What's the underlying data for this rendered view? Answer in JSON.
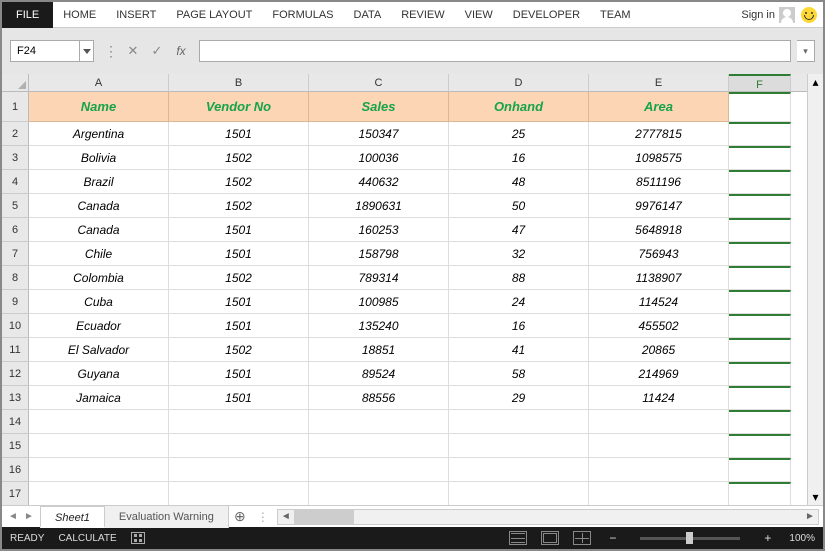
{
  "ribbon": {
    "file": "FILE",
    "tabs": [
      "HOME",
      "INSERT",
      "PAGE LAYOUT",
      "FORMULAS",
      "DATA",
      "REVIEW",
      "VIEW",
      "DEVELOPER",
      "TEAM"
    ],
    "signin": "Sign in"
  },
  "namebox": {
    "value": "F24"
  },
  "fx_label": "fx",
  "formula": {
    "value": ""
  },
  "columns": [
    "A",
    "B",
    "C",
    "D",
    "E",
    "F"
  ],
  "header_row": [
    "Name",
    "Vendor No",
    "Sales",
    "Onhand",
    "Area"
  ],
  "chart_data": {
    "type": "table",
    "columns": [
      "Name",
      "Vendor No",
      "Sales",
      "Onhand",
      "Area"
    ],
    "rows": [
      [
        "Argentina",
        "1501",
        "150347",
        "25",
        "2777815"
      ],
      [
        "Bolivia",
        "1502",
        "100036",
        "16",
        "1098575"
      ],
      [
        "Brazil",
        "1502",
        "440632",
        "48",
        "8511196"
      ],
      [
        "Canada",
        "1502",
        "1890631",
        "50",
        "9976147"
      ],
      [
        "Canada",
        "1501",
        "160253",
        "47",
        "5648918"
      ],
      [
        "Chile",
        "1501",
        "158798",
        "32",
        "756943"
      ],
      [
        "Colombia",
        "1502",
        "789314",
        "88",
        "1138907"
      ],
      [
        "Cuba",
        "1501",
        "100985",
        "24",
        "114524"
      ],
      [
        "Ecuador",
        "1501",
        "135240",
        "16",
        "455502"
      ],
      [
        "El Salvador",
        "1502",
        "18851",
        "41",
        "20865"
      ],
      [
        "Guyana",
        "1501",
        "89524",
        "58",
        "214969"
      ],
      [
        "Jamaica",
        "1501",
        "88556",
        "29",
        "11424"
      ]
    ]
  },
  "row_numbers": [
    "1",
    "2",
    "3",
    "4",
    "5",
    "6",
    "7",
    "8",
    "9",
    "10",
    "11",
    "12",
    "13",
    "14",
    "15",
    "16",
    "17"
  ],
  "sheets": {
    "active": "Sheet1",
    "other": "Evaluation Warning"
  },
  "status": {
    "ready": "READY",
    "calc": "CALCULATE",
    "zoom": "100%"
  },
  "colors": {
    "header_bg": "#fcd5b4",
    "header_fg": "#16a34a"
  }
}
